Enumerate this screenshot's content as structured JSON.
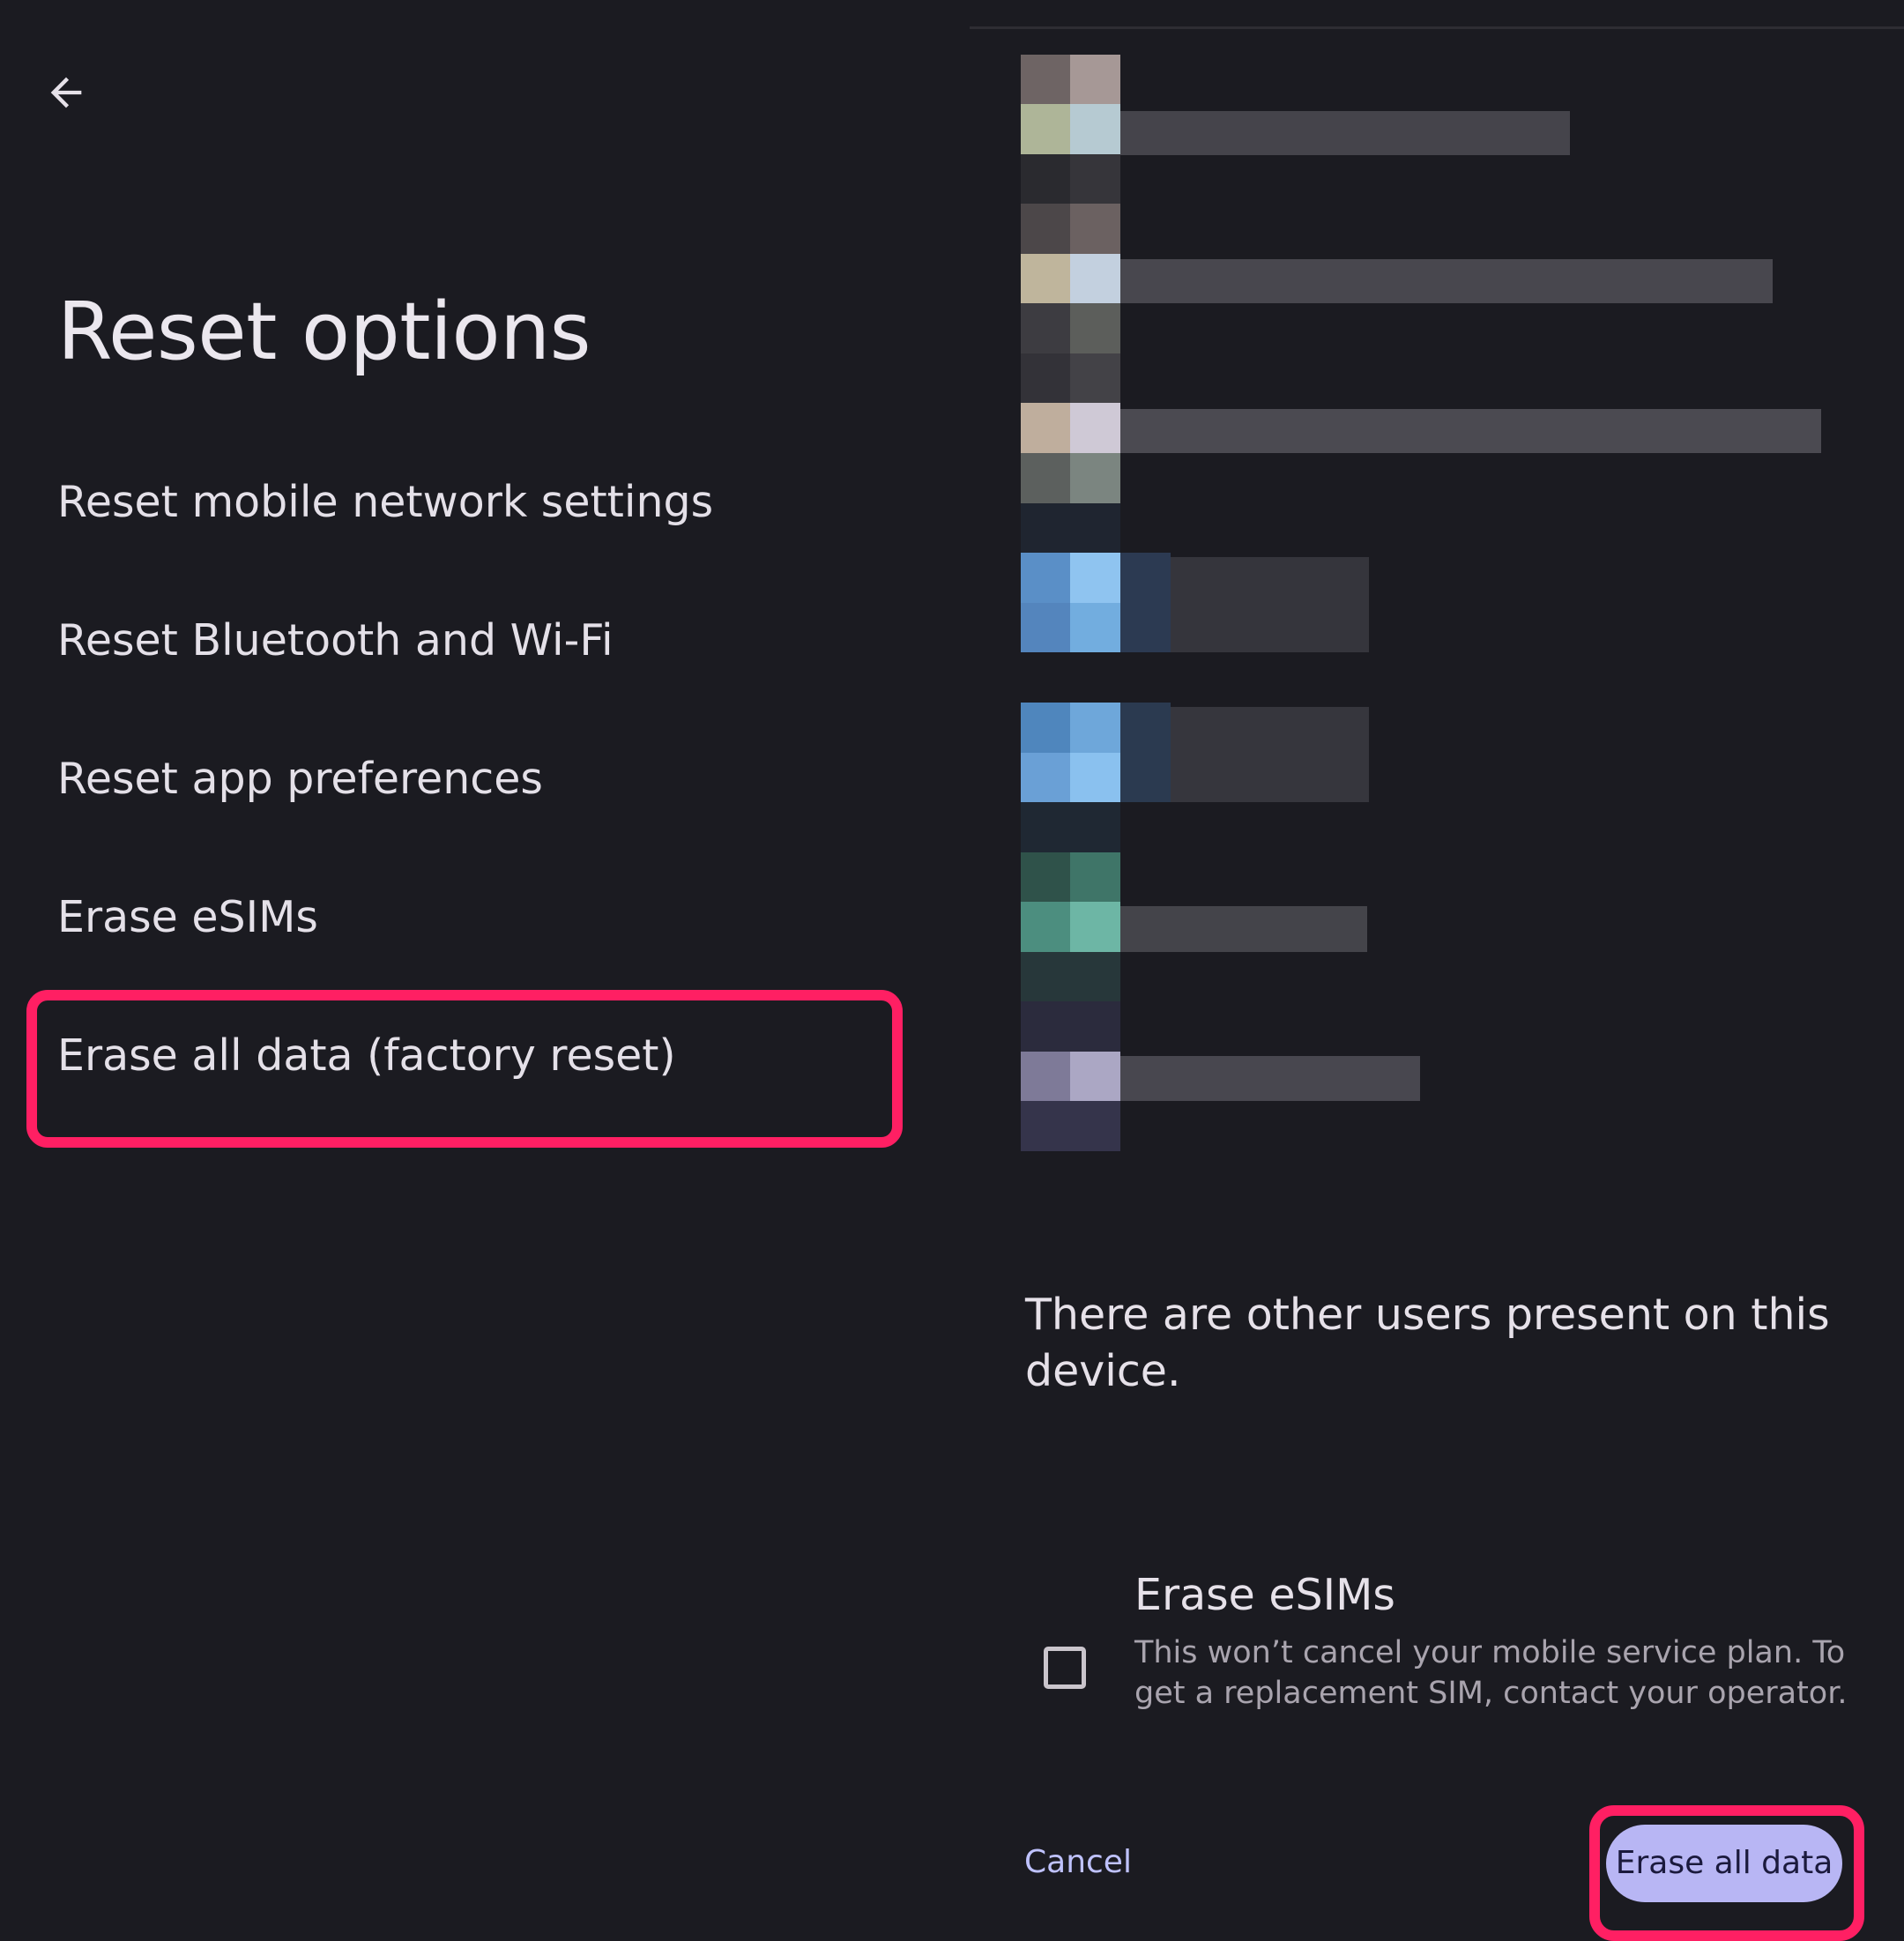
{
  "header": {
    "back_icon": "arrow-left-icon",
    "title": "Reset options"
  },
  "options": [
    {
      "label": "Reset mobile network settings"
    },
    {
      "label": "Reset Bluetooth and Wi-Fi"
    },
    {
      "label": "Reset app preferences"
    },
    {
      "label": "Erase eSIMs"
    },
    {
      "label": "Erase all data (factory reset)"
    }
  ],
  "dialog": {
    "warning": "There are other users present on this device.",
    "erase_esims": {
      "title": "Erase eSIMs",
      "description": "This won’t cancel your mobile service plan. To get a replacement SIM, contact your operator.",
      "checked": false
    },
    "cancel_label": "Cancel",
    "confirm_label": "Erase all data"
  },
  "colors": {
    "background": "#1b1b21",
    "highlight": "#ff1f63",
    "primary_button": "#b8b6f4",
    "link": "#bfc2ff"
  }
}
